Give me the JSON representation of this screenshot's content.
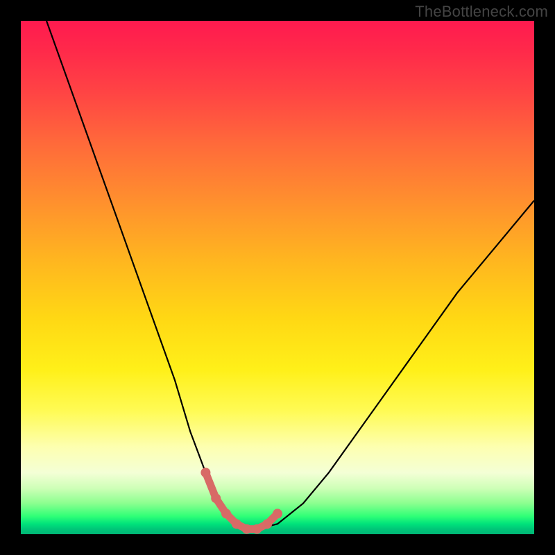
{
  "watermark": "TheBottleneck.com",
  "colors": {
    "page_bg": "#000000",
    "curve": "#000000",
    "marker": "#d86a66"
  },
  "chart_data": {
    "type": "line",
    "title": "",
    "xlabel": "",
    "ylabel": "",
    "xlim": [
      0,
      100
    ],
    "ylim": [
      0,
      100
    ],
    "grid": false,
    "legend": false,
    "series": [
      {
        "name": "bottleneck-curve",
        "x": [
          5,
          10,
          15,
          20,
          25,
          30,
          33,
          36,
          38,
          40,
          42,
          44,
          46,
          50,
          55,
          60,
          65,
          70,
          75,
          80,
          85,
          90,
          95,
          100
        ],
        "y": [
          100,
          86,
          72,
          58,
          44,
          30,
          20,
          12,
          7,
          4,
          2,
          1,
          1,
          2,
          6,
          12,
          19,
          26,
          33,
          40,
          47,
          53,
          59,
          65
        ]
      }
    ],
    "markers": {
      "name": "highlighted-range",
      "x": [
        36,
        38,
        40,
        42,
        44,
        46,
        48,
        50
      ],
      "y": [
        12,
        7,
        4,
        2,
        1,
        1,
        2,
        4
      ]
    },
    "background_gradient": [
      {
        "pos": 0.0,
        "color": "#ff1a4f"
      },
      {
        "pos": 0.5,
        "color": "#ffd814"
      },
      {
        "pos": 0.8,
        "color": "#fdffb0"
      },
      {
        "pos": 0.95,
        "color": "#30ff77"
      },
      {
        "pos": 1.0,
        "color": "#00b676"
      }
    ]
  }
}
